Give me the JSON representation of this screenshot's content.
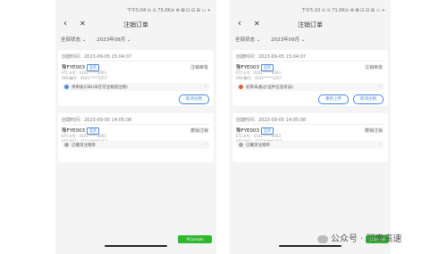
{
  "phones": [
    {
      "status_bar": "下午5:04 ⊙ ⊙ 75.0K/s ⊗ ⊠ ⊡ ⊟ ⊞ ▭ +",
      "title": "注销订单",
      "filter_left": "全部状态 ⌄",
      "filter_right": "2023年09月 ⌄",
      "cards": [
        {
          "time": "创建时间：2023-09-05 15:04:07",
          "plate": "豫FYE003",
          "plate_tag": "蓝黑",
          "status": "注销审批",
          "info1": "ETC卡号：4101*****0003",
          "info2": "OBU编号：4101*****2257",
          "notice": "待审核(OBU未在可注销道注销)",
          "notice_color": "#4a8ae0",
          "buttons": [
            "取消注销"
          ]
        },
        {
          "time": "创建时间：2023-09-05 14:05:08",
          "plate": "豫FYE003",
          "plate_tag": "蓝黑",
          "status": "撤销注销",
          "info1": "ETC卡号：4101*****0003",
          "info2": "OBU编号：4101*****2257",
          "notice": "已撤消注销单",
          "notice_color": "#aaaaaa",
          "buttons": []
        }
      ],
      "green_button": "#Console"
    },
    {
      "status_bar": "下午5:10 ⊙ ⊙ 71.0K/s ⊗ ⊠ ⊡ ⊟ ⊞ ▭ +",
      "title": "注销订单",
      "filter_left": "全部状态 ⌄",
      "filter_right": "2023年09月 ⌄",
      "cards": [
        {
          "time": "创建时间：2023-09-05 15:04:07",
          "plate": "豫FYE003",
          "plate_tag": "蓝黑",
          "status": "注销审批",
          "info1": "ETC卡号：4101*****0003",
          "info2": "OBU编号：4101*****2257",
          "notice": "初审未通过(证件信息有误)",
          "notice_color": "#e05a3a",
          "buttons": [
            "重新上传",
            "取消注销"
          ]
        },
        {
          "time": "创建时间：2023-09-05 14:05:08",
          "plate": "豫FYE003",
          "plate_tag": "蓝黑",
          "status": "撤销注销",
          "info1": "ETC卡号：4101*****0003",
          "info2": "OBU编号：4101*****2257",
          "notice": "已撤消注销单",
          "notice_color": "#aaaaaa",
          "buttons": []
        }
      ],
      "green_button": "#Console"
    }
  ],
  "watermark": "公众号 · 河南高速"
}
